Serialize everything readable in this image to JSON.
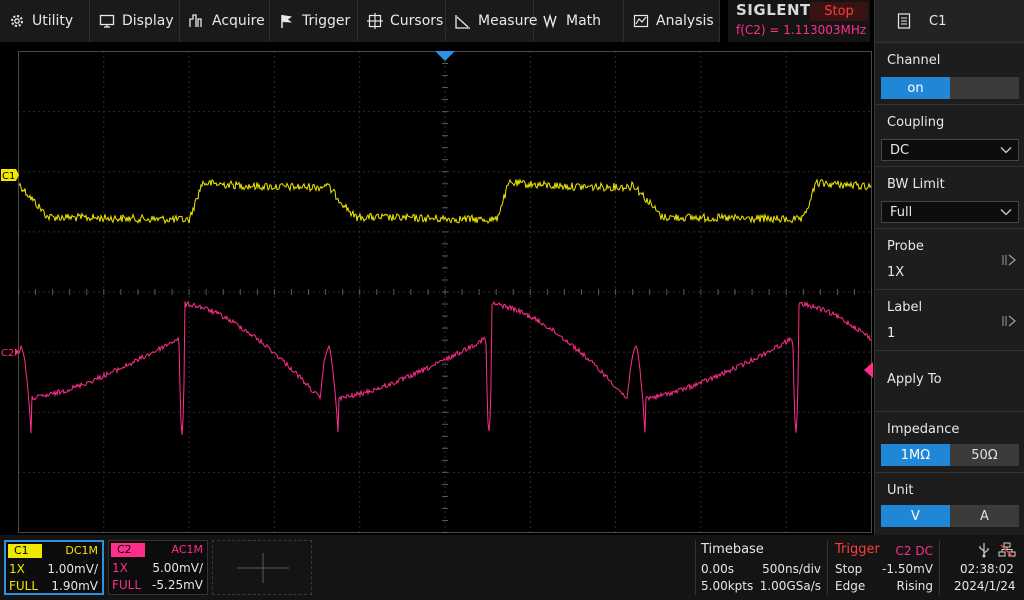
{
  "menu": {
    "items": [
      {
        "label": "Utility",
        "icon": "gear-icon"
      },
      {
        "label": "Display",
        "icon": "monitor-icon"
      },
      {
        "label": "Acquire",
        "icon": "acquire-icon"
      },
      {
        "label": "Trigger",
        "icon": "flag-icon"
      },
      {
        "label": "Cursors",
        "icon": "crosshair-icon"
      },
      {
        "label": "Measure",
        "icon": "measure-icon"
      },
      {
        "label": "Math",
        "icon": "math-icon"
      },
      {
        "label": "Analysis",
        "icon": "analysis-icon"
      }
    ]
  },
  "brand": {
    "logo": "SIGLENT",
    "run_state": "Stop",
    "freq_readout": "f(C2) = 1.113003MHz"
  },
  "panel": {
    "title": "C1",
    "channel": {
      "title": "Channel",
      "on_label": "on"
    },
    "coupling": {
      "title": "Coupling",
      "value": "DC"
    },
    "bw_limit": {
      "title": "BW Limit",
      "value": "Full"
    },
    "probe": {
      "title": "Probe",
      "value": "1X"
    },
    "label": {
      "title": "Label",
      "value": "1"
    },
    "apply_to": {
      "title": "Apply To"
    },
    "impedance": {
      "title": "Impedance",
      "options": [
        "1MΩ",
        "50Ω"
      ],
      "selected": 0
    },
    "unit": {
      "title": "Unit",
      "options": [
        "V",
        "A"
      ],
      "selected": 0
    }
  },
  "channels": {
    "c1": {
      "tag": "C1",
      "coupling": "DC1M",
      "probe": "1X",
      "scale": "1.00mV/",
      "bw": "FULL",
      "offset": "1.90mV",
      "color": "#f0e800"
    },
    "c2": {
      "tag": "C2",
      "coupling": "AC1M",
      "probe": "1X",
      "scale": "5.00mV/",
      "bw": "FULL",
      "offset": "-5.25mV",
      "color": "#ff2e8a"
    }
  },
  "timebase": {
    "title": "Timebase",
    "delay": "0.00s",
    "scale": "500ns/div",
    "memory": "5.00kpts",
    "sample_rate": "1.00GSa/s"
  },
  "trigger": {
    "title": "Trigger",
    "source": "C2 DC",
    "state": "Stop",
    "level": "-1.50mV",
    "type": "Edge",
    "slope": "Rising"
  },
  "clock": {
    "time": "02:38:02",
    "date": "2024/1/24"
  },
  "colors": {
    "accent": "#1f87d6",
    "c1": "#f0e800",
    "c2": "#ff2e8a",
    "stop_red": "#ff3c3c",
    "trigger_red": "#ff3c3c"
  }
}
